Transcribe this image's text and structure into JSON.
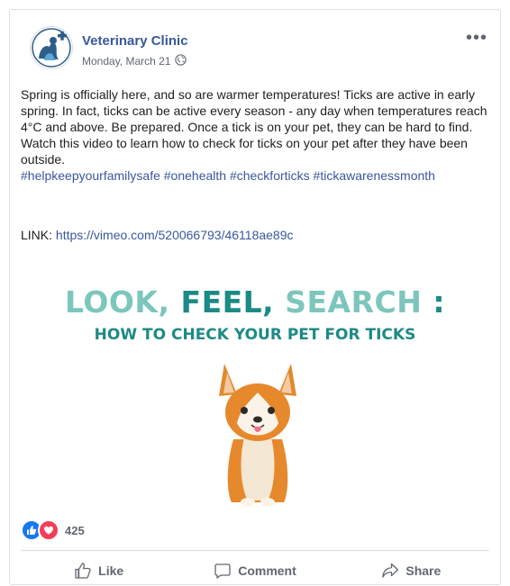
{
  "post": {
    "page_name": "Veterinary Clinic",
    "date": "Monday, March 21",
    "privacy_icon": "globe-icon",
    "more_label": "•••",
    "text": "Spring is officially here, and so are warmer temperatures! Ticks are active in early spring. In fact, ticks can be active every season - any day when temperatures reach 4°C and above. Be prepared. Once a tick is on your pet, they can be hard to find. Watch this video to learn how to check for ticks on your pet after they have been outside.",
    "hashtags": [
      "#helpkeepyourfamilysafe",
      "#onehealth",
      "#checkforticks",
      "#tickawarenessmonth"
    ],
    "link_label": "LINK:",
    "link_url": "https://vimeo.com/520066793/46118ae89c"
  },
  "media": {
    "title_part1": "LOOK, ",
    "title_part2": "FEEL, ",
    "title_part3": "SEARCH",
    "title_colon": " :",
    "subtitle": "HOW TO CHECK YOUR PET FOR TICKS",
    "illustration": "corgi-dog-illustration"
  },
  "reactions": {
    "icons": [
      "like-reaction-icon",
      "love-reaction-icon"
    ],
    "count": "425"
  },
  "actions": {
    "like": "Like",
    "comment": "Comment",
    "share": "Share"
  },
  "colors": {
    "link": "#385898",
    "title_light": "#7cc6bc",
    "title_dark": "#1d8a86",
    "like_blue": "#1877f2",
    "love_red": "#f33e58"
  }
}
